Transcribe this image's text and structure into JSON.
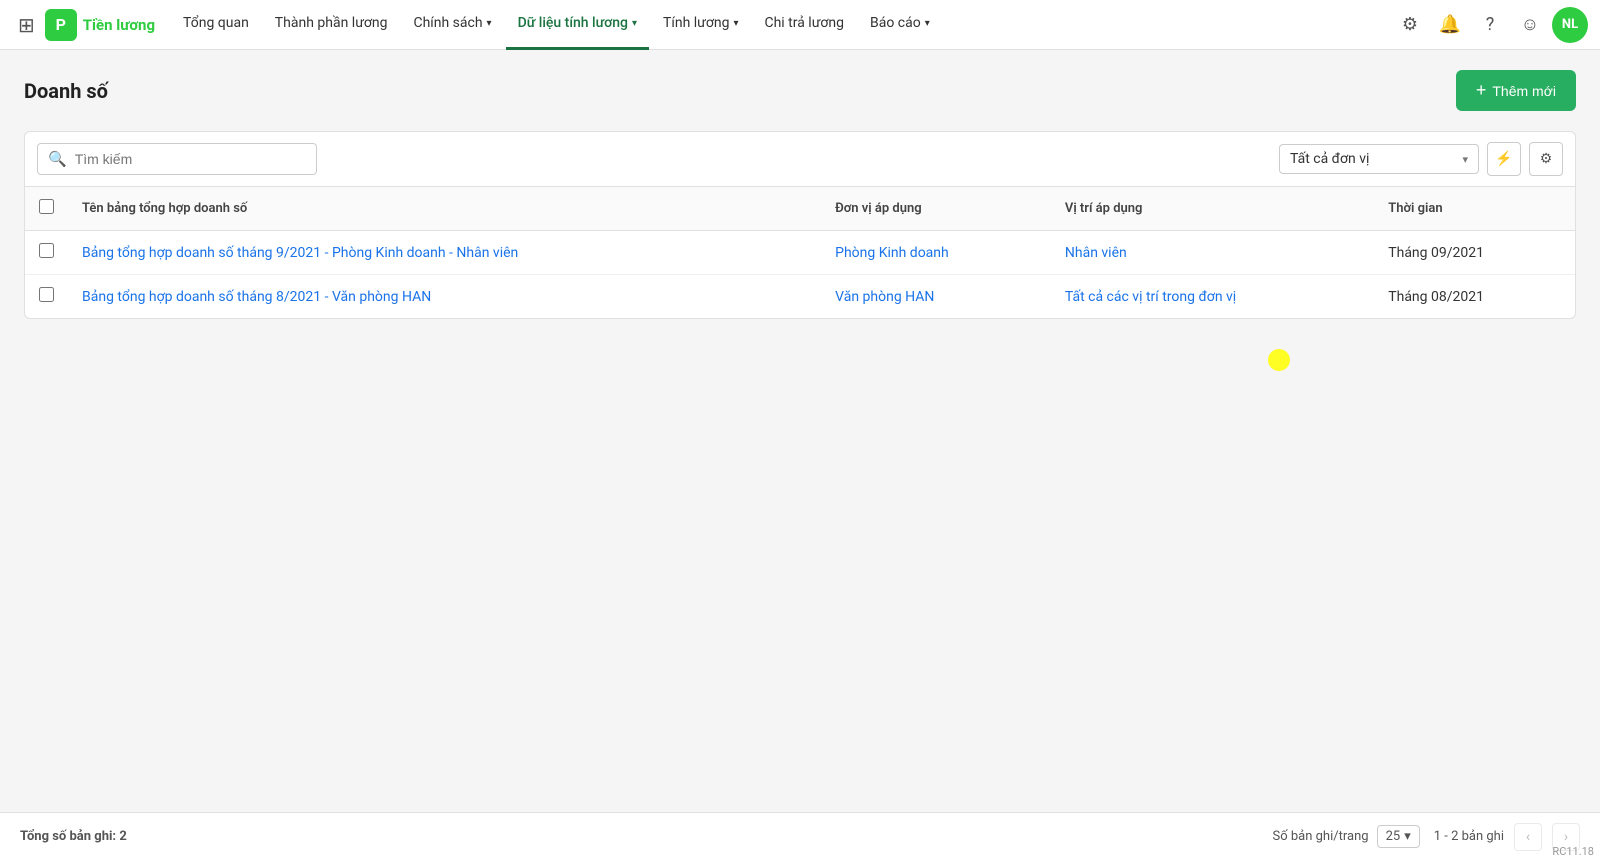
{
  "app": {
    "logo_letter": "P",
    "logo_text": "Tiền lương",
    "version": "RC11.18"
  },
  "nav": {
    "items": [
      {
        "label": "Tổng quan",
        "active": false,
        "has_dropdown": false
      },
      {
        "label": "Thành phần lương",
        "active": false,
        "has_dropdown": false
      },
      {
        "label": "Chính sách",
        "active": false,
        "has_dropdown": true
      },
      {
        "label": "Dữ liệu tính lương",
        "active": true,
        "has_dropdown": true
      },
      {
        "label": "Tính lương",
        "active": false,
        "has_dropdown": true
      },
      {
        "label": "Chi trả lương",
        "active": false,
        "has_dropdown": false
      },
      {
        "label": "Báo cáo",
        "active": false,
        "has_dropdown": true
      }
    ],
    "avatar_text": "NL"
  },
  "page": {
    "title": "Doanh số",
    "add_button": "Thêm mới"
  },
  "toolbar": {
    "search_placeholder": "Tìm kiếm",
    "filter_label": "Tất cả đơn vị",
    "filter_chevron": "▾"
  },
  "table": {
    "columns": [
      {
        "key": "name",
        "label": "Tên bảng tổng hợp doanh số"
      },
      {
        "key": "unit",
        "label": "Đơn vị áp dụng"
      },
      {
        "key": "position",
        "label": "Vị trí áp dụng"
      },
      {
        "key": "time",
        "label": "Thời gian"
      }
    ],
    "rows": [
      {
        "name": "Bảng tổng hợp doanh số tháng 9/2021 - Phòng Kinh doanh - Nhân viên",
        "unit": "Phòng Kinh doanh",
        "position": "Nhân viên",
        "time": "Tháng 09/2021"
      },
      {
        "name": "Bảng tổng hợp doanh số tháng 8/2021 - Văn phòng HAN",
        "unit": "Văn phòng HAN",
        "position": "Tất cả các vị trí trong đơn vị",
        "time": "Tháng 08/2021"
      }
    ]
  },
  "footer": {
    "total_label": "Tổng số bản ghi:",
    "total_count": "2",
    "per_page_label": "Số bản ghi/trang",
    "per_page_value": "25",
    "pagination_range": "1 - 2 bản ghi"
  }
}
